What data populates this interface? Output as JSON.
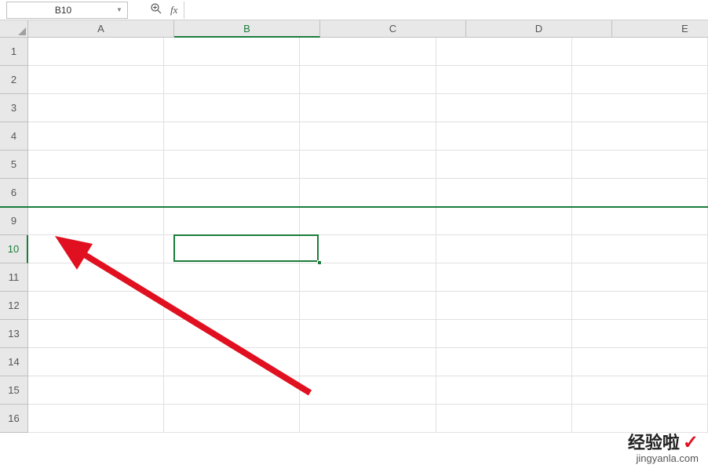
{
  "nameBox": {
    "value": "B10"
  },
  "formulaBar": {
    "value": ""
  },
  "columns": [
    {
      "label": "A",
      "active": false
    },
    {
      "label": "B",
      "active": true
    },
    {
      "label": "C",
      "active": false
    },
    {
      "label": "D",
      "active": false
    },
    {
      "label": "E",
      "active": false
    }
  ],
  "rows": [
    {
      "label": "1",
      "active": false
    },
    {
      "label": "2",
      "active": false
    },
    {
      "label": "3",
      "active": false
    },
    {
      "label": "4",
      "active": false
    },
    {
      "label": "5",
      "active": false
    },
    {
      "label": "6",
      "active": false
    },
    {
      "label": "9",
      "active": false
    },
    {
      "label": "10",
      "active": true
    },
    {
      "label": "11",
      "active": false
    },
    {
      "label": "12",
      "active": false
    },
    {
      "label": "13",
      "active": false
    },
    {
      "label": "14",
      "active": false
    },
    {
      "label": "15",
      "active": false
    },
    {
      "label": "16",
      "active": false
    }
  ],
  "hiddenRowsBreak": {
    "afterVisibleRowIndex": 5
  },
  "selection": {
    "cell": "B10",
    "colIndex": 1,
    "visibleRowIndex": 7
  },
  "watermark": {
    "main": "经验啦",
    "check": "✓",
    "sub": "jingyanla.com"
  }
}
